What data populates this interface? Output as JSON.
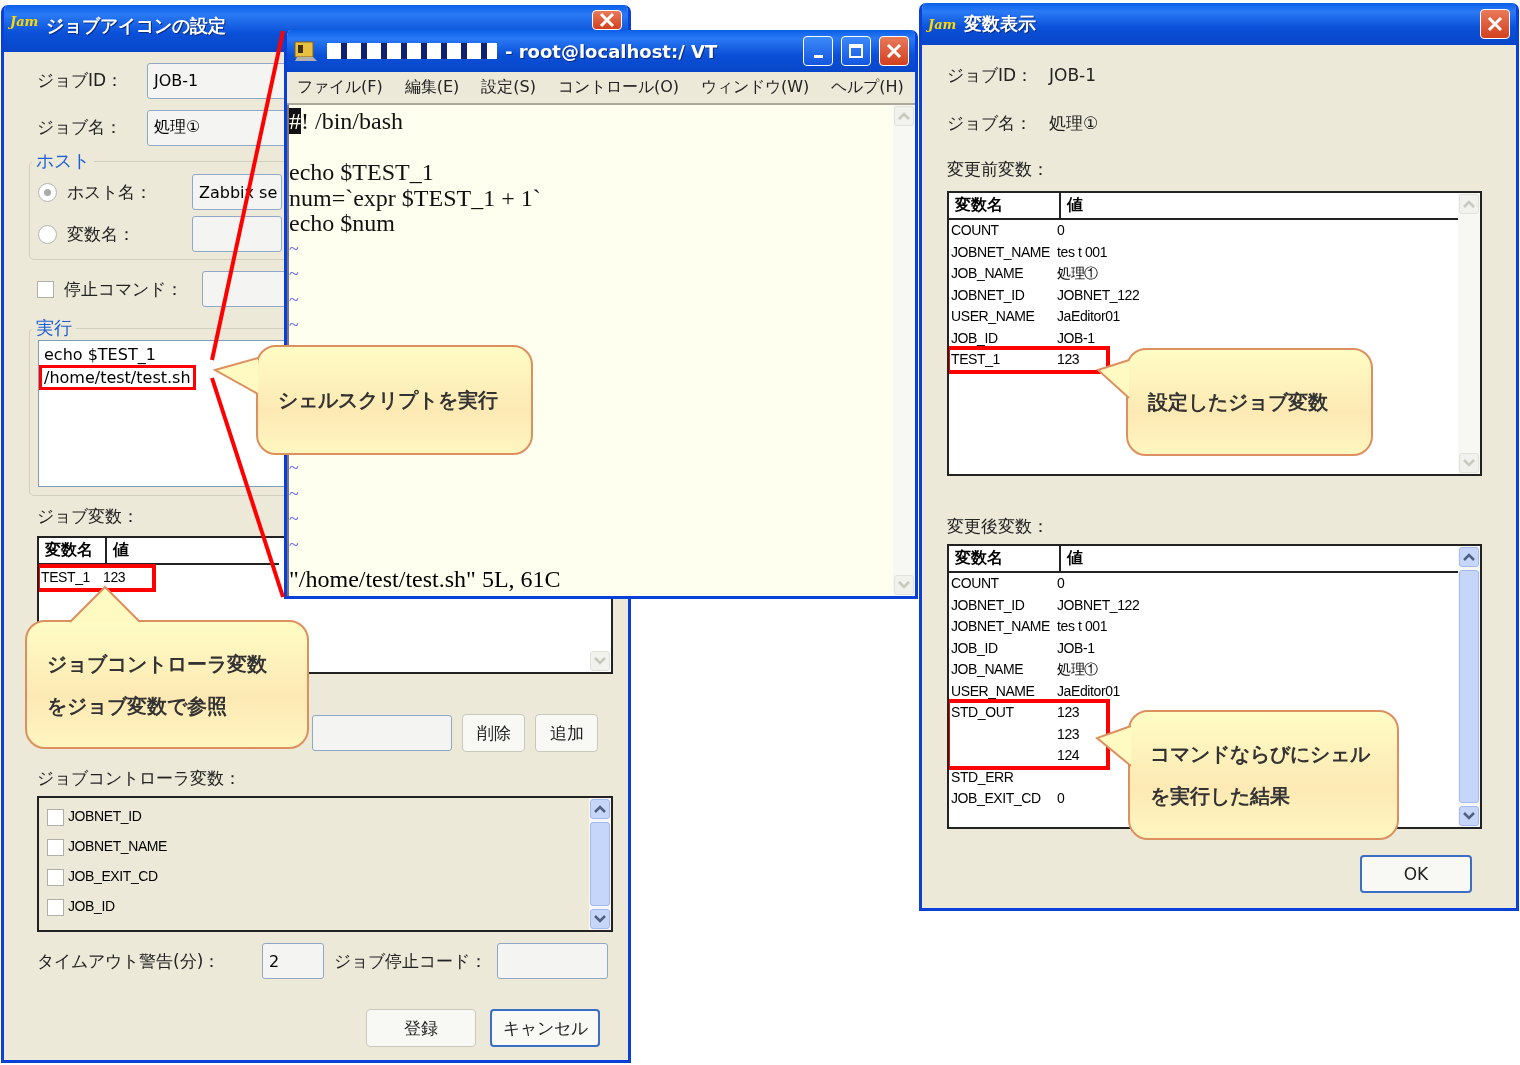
{
  "job_icon_window": {
    "logo": "Jam",
    "title": "ジョブアイコンの設定",
    "job_id": {
      "label": "ジョブID：",
      "value": "JOB-1"
    },
    "job_name": {
      "label": "ジョブ名：",
      "value": "処理①"
    },
    "host_group": {
      "legend": "ホスト",
      "options": [
        {
          "label": "ホスト名：",
          "selected": true,
          "value": "Zabbix se"
        },
        {
          "label": "変数名：",
          "selected": false
        }
      ]
    },
    "stop_command": {
      "label": "停止コマンド：",
      "checked": false
    },
    "exec_group": {
      "legend": "実行",
      "lines": [
        {
          "text": "echo $TEST_1",
          "highlighted": false
        },
        {
          "text": "/home/test/test.sh",
          "highlighted": true
        }
      ]
    },
    "job_variables": {
      "label": "ジョブ変数：",
      "columns": [
        "変数名",
        "値"
      ],
      "rows": [
        {
          "name": "TEST_1",
          "value": "123",
          "highlighted": true
        }
      ]
    },
    "variable_buttons": [
      "削除",
      "追加"
    ],
    "controller_variables": {
      "label": "ジョブコントローラ変数：",
      "items": [
        {
          "label": "JOBNET_ID",
          "checked": false
        },
        {
          "label": "JOBNET_NAME",
          "checked": false
        },
        {
          "label": "JOB_EXIT_CD",
          "checked": false
        },
        {
          "label": "JOB_ID",
          "checked": false
        }
      ]
    },
    "timeout": {
      "label": "タイムアウト警告(分)：",
      "value": "2"
    },
    "stop_code": {
      "label": "ジョブ停止コード："
    },
    "buttons": [
      {
        "label": "登録",
        "default": false
      },
      {
        "label": "キャンセル",
        "default": true
      }
    ]
  },
  "terminal_window": {
    "title": "- root@localhost:/ VT",
    "menu": [
      "ファイル(F)",
      "編集(E)",
      "設定(S)",
      "コントロール(O)",
      "ウィンドウ(W)",
      "ヘルプ(H)"
    ],
    "lines": [
      {
        "kind": "cursor",
        "text": "#! /bin/bash"
      },
      {
        "kind": "blank"
      },
      {
        "kind": "text",
        "text": "echo $TEST_1"
      },
      {
        "kind": "text",
        "text": "num=`expr $TEST_1 + 1`"
      },
      {
        "kind": "text",
        "text": "echo $num"
      },
      {
        "kind": "tilde",
        "text": "~"
      },
      {
        "kind": "tilde",
        "text": "~"
      },
      {
        "kind": "tilde",
        "text": "~"
      },
      {
        "kind": "tilde",
        "text": "~"
      }
    ],
    "lines_below": [
      {
        "kind": "tilde",
        "text": "~"
      },
      {
        "kind": "tilde",
        "text": "~"
      },
      {
        "kind": "tilde",
        "text": "~"
      },
      {
        "kind": "tilde",
        "text": "~"
      }
    ],
    "status": "\"/home/test/test.sh\" 5L, 61C"
  },
  "variables_window": {
    "logo": "Jam",
    "title": "変数表示",
    "job_id": {
      "label": "ジョブID：",
      "value": "JOB-1"
    },
    "job_name": {
      "label": "ジョブ名：",
      "value": "処理①"
    },
    "before": {
      "label": "変更前変数：",
      "columns": [
        "変数名",
        "値"
      ],
      "rows": [
        {
          "name": "COUNT",
          "value": "0",
          "highlighted": false
        },
        {
          "name": "JOBNET_NAME",
          "value": "tes t 001",
          "highlighted": false
        },
        {
          "name": "JOB_NAME",
          "value": "処理①",
          "highlighted": false
        },
        {
          "name": "JOBNET_ID",
          "value": "JOBNET_122",
          "highlighted": false
        },
        {
          "name": "USER_NAME",
          "value": "JaEditor01",
          "highlighted": false
        },
        {
          "name": "JOB_ID",
          "value": "JOB-1",
          "highlighted": false
        },
        {
          "name": "TEST_1",
          "value": "123",
          "highlighted": true
        }
      ]
    },
    "after": {
      "label": "変更後変数：",
      "columns": [
        "変数名",
        "値"
      ],
      "rows": [
        {
          "name": "COUNT",
          "value": "0",
          "highlighted": false
        },
        {
          "name": "JOBNET_ID",
          "value": "JOBNET_122",
          "highlighted": false
        },
        {
          "name": "JOBNET_NAME",
          "value": "tes t 001",
          "highlighted": false
        },
        {
          "name": "JOB_ID",
          "value": "JOB-1",
          "highlighted": false
        },
        {
          "name": "JOB_NAME",
          "value": "処理①",
          "highlighted": false
        },
        {
          "name": "USER_NAME",
          "value": "JaEditor01",
          "highlighted": false
        },
        {
          "name": "STD_OUT",
          "value": "123\n123\n124",
          "highlighted": true
        },
        {
          "name": "STD_ERR",
          "highlighted": false
        },
        {
          "name": "JOB_EXIT_CD",
          "value": "0",
          "highlighted": false
        }
      ]
    },
    "ok_button": "OK"
  },
  "callouts": [
    {
      "text": "シェルスクリプトを実行"
    },
    {
      "text": "ジョブコントローラ変数をジョブ変数で参照"
    },
    {
      "text": "設定したジョブ変数"
    },
    {
      "text": "コマンドならびにシェルを実行した結果"
    }
  ]
}
